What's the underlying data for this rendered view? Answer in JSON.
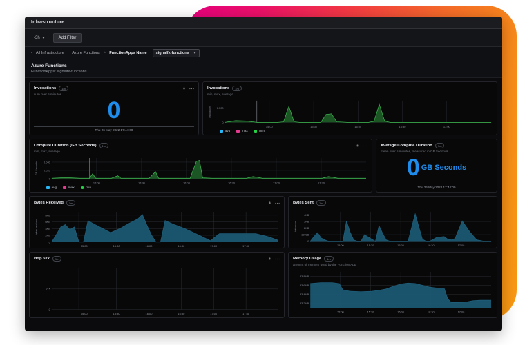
{
  "window": {
    "title": "Infrastructure"
  },
  "toolbar": {
    "time_range": "-3h",
    "add_filter_label": "Add Filter"
  },
  "breadcrumb": {
    "back_icon": "chevron-left-icon",
    "root": "All Infrastructure",
    "separator_1": "|",
    "section": "Azure Functions",
    "separator_2": ">",
    "label": "FunctionApps Name",
    "selected_value": "signalfx-functions",
    "caret_icon": "chevron-down-icon"
  },
  "page": {
    "title": "Azure Functions",
    "subtitle": "FunctionApps: signalfx-functions"
  },
  "icons": {
    "bell": "bell-icon",
    "dots": "more-options-icon"
  },
  "panels": {
    "invocations_single": {
      "title": "Invocations",
      "badge": "1m",
      "subtitle": "sum over 5 minutes",
      "value": "0",
      "footer": "Thu 26 May 2022 17:44:00"
    },
    "invocations_chart": {
      "title": "Invocations",
      "badge": "1m",
      "subtitle": "min, max, average"
    },
    "compute_duration": {
      "title": "Compute Duration (GB Seconds)",
      "badge": "1m",
      "subtitle": "min, max, average"
    },
    "avg_compute_duration": {
      "title": "Average Compute Duration",
      "badge": "1m",
      "subtitle": "mean over 5 minutes, measured in GB Seconds",
      "value": "0",
      "unit": "GB Seconds",
      "footer": "Thu 26 May 2022 17:44:00"
    },
    "bytes_received": {
      "title": "Bytes Received",
      "badge": "1m"
    },
    "bytes_sent": {
      "title": "Bytes Sent",
      "badge": "1m"
    },
    "http_5xx": {
      "title": "Http 5xx",
      "badge": "1m"
    },
    "memory_usage": {
      "title": "Memory Usage",
      "badge": "1m",
      "subtitle": "amount of memory used by the Function App"
    }
  },
  "legend": {
    "avg": {
      "label": "avg",
      "color": "#29b6f6"
    },
    "max": {
      "label": "max",
      "color": "#e3398f"
    },
    "min": {
      "label": "min",
      "color": "#27d145"
    }
  },
  "colors": {
    "accent_blue": "#1f8ceb",
    "area_teal": "#1f607d",
    "line_green": "#3fbf53",
    "gradient_start": "#e5007d",
    "gradient_end": "#f99a12"
  },
  "chart_data": [
    {
      "id": "invocations_chart",
      "type": "area",
      "title": "Invocations",
      "ylabel": "invocations",
      "xlabel": "",
      "ylim": [
        0,
        0.75
      ],
      "yticks": [
        "0",
        "0.500"
      ],
      "ytick_values": [
        0,
        0.5
      ],
      "xticks": [
        "15:00",
        "15:30",
        "16:00",
        "16:30",
        "17:00"
      ],
      "grid": true,
      "legend_position": "bottom-left",
      "series": [
        {
          "name": "min",
          "color": "#3fbf53",
          "x": [
            0,
            4,
            8,
            12,
            16,
            20,
            22,
            24,
            26,
            28,
            32,
            36,
            38,
            40,
            42,
            46,
            50,
            54,
            56,
            58,
            60,
            62,
            66,
            70,
            74,
            78,
            82,
            86,
            90,
            94,
            100
          ],
          "values": [
            0,
            0.06,
            0.05,
            0,
            0,
            0,
            0.02,
            0.55,
            0.02,
            0,
            0,
            0,
            0.28,
            0.3,
            0.02,
            0,
            0,
            0,
            0.04,
            0.62,
            0.05,
            0,
            0,
            0,
            0,
            0,
            0,
            0,
            0,
            0,
            0
          ]
        },
        {
          "name": "max",
          "color": "#e3398f",
          "x": [],
          "values": []
        },
        {
          "name": "avg",
          "color": "#29b6f6",
          "x": [],
          "values": []
        }
      ]
    },
    {
      "id": "compute_duration",
      "type": "area",
      "title": "Compute Duration (GB Seconds)",
      "ylabel": "GB Seconds",
      "xlabel": "",
      "ylim": [
        0,
        0.05
      ],
      "yticks": [
        "0",
        "0.020",
        "0.040"
      ],
      "ytick_values": [
        0,
        0.02,
        0.04
      ],
      "xticks": [
        "15:00",
        "15:30",
        "16:00",
        "16:30",
        "17:00",
        "17:30"
      ],
      "grid": true,
      "legend_position": "bottom-left",
      "series": [
        {
          "name": "min",
          "color": "#3fbf53",
          "x": [
            0,
            3,
            6,
            9,
            12,
            13,
            14,
            16,
            19,
            21,
            22,
            24,
            27,
            31,
            33,
            34,
            36,
            40,
            44,
            46,
            47,
            48,
            51,
            56,
            62,
            64,
            65,
            67,
            72,
            78,
            86,
            88,
            89,
            91,
            96,
            100
          ],
          "values": [
            0.001,
            0.002,
            0.002,
            0.001,
            0.001,
            0.012,
            0.001,
            0.001,
            0.001,
            0.007,
            0.001,
            0.001,
            0.001,
            0.001,
            0.017,
            0.001,
            0.001,
            0.001,
            0.001,
            0.042,
            0.044,
            0.002,
            0.001,
            0.001,
            0.001,
            0.005,
            0.004,
            0.001,
            0.001,
            0.001,
            0.001,
            0.005,
            0.004,
            0.001,
            0.001,
            0.001
          ]
        },
        {
          "name": "max",
          "color": "#e3398f",
          "x": [],
          "values": []
        },
        {
          "name": "avg",
          "color": "#29b6f6",
          "x": [],
          "values": []
        }
      ]
    },
    {
      "id": "bytes_received",
      "type": "area",
      "title": "Bytes Received",
      "ylabel": "bytes received",
      "xlabel": "",
      "ylim": [
        0,
        9000
      ],
      "yticks": [
        "0",
        "2KB",
        "4KB",
        "6KB",
        "8KB"
      ],
      "ytick_values": [
        0,
        2000,
        4000,
        6000,
        8000
      ],
      "xticks": [
        "15:00",
        "15:30",
        "16:00",
        "16:30",
        "17:00",
        "17:30"
      ],
      "grid": true,
      "series": [
        {
          "name": "bytes received",
          "color": "#1f607d",
          "x": [
            0,
            2,
            4,
            6,
            8,
            10,
            12,
            14,
            16,
            18,
            22,
            26,
            30,
            34,
            38,
            40,
            42,
            44,
            46,
            48,
            50,
            54,
            58,
            62,
            66,
            70,
            74,
            78,
            82,
            90,
            96,
            100
          ],
          "values": [
            0,
            2200,
            4500,
            5200,
            3700,
            4500,
            0,
            0,
            6400,
            5600,
            4200,
            2800,
            4000,
            5500,
            6900,
            8200,
            5000,
            2100,
            0,
            0,
            6400,
            5200,
            4200,
            3000,
            1700,
            400,
            2500,
            2500,
            2500,
            2500,
            1500,
            500
          ]
        }
      ]
    },
    {
      "id": "bytes_sent",
      "type": "area",
      "title": "Bytes Sent",
      "ylabel": "bytes sent",
      "xlabel": "",
      "ylim": [
        0,
        4500
      ],
      "yticks": [
        "0",
        "1000B",
        "2KB",
        "3KB",
        "4KB"
      ],
      "ytick_values": [
        0,
        1000,
        2000,
        3000,
        4000
      ],
      "xticks": [
        "15:00",
        "15:30",
        "16:00",
        "16:30",
        "17:00"
      ],
      "grid": true,
      "series": [
        {
          "name": "bytes sent",
          "color": "#1f607d",
          "x": [
            0,
            2,
            4,
            6,
            8,
            10,
            14,
            18,
            20,
            22,
            24,
            26,
            28,
            30,
            34,
            36,
            38,
            40,
            42,
            44,
            46,
            50,
            54,
            58,
            60,
            62,
            64,
            66,
            70,
            74,
            76,
            78,
            80,
            84,
            88,
            92,
            96,
            100
          ],
          "values": [
            0,
            700,
            1300,
            500,
            200,
            0,
            0,
            0,
            3100,
            1400,
            200,
            0,
            0,
            1000,
            300,
            0,
            2400,
            1200,
            200,
            0,
            0,
            0,
            0,
            4200,
            2200,
            300,
            0,
            0,
            600,
            700,
            300,
            200,
            400,
            3100,
            1500,
            200,
            0,
            0
          ]
        }
      ]
    },
    {
      "id": "http_5xx",
      "type": "line",
      "title": "Http 5xx",
      "ylabel": "",
      "xlabel": "",
      "ylim": [
        0,
        1
      ],
      "yticks": [
        "0",
        "0.5"
      ],
      "ytick_values": [
        0,
        0.5
      ],
      "xticks": [
        "15:00",
        "15:30",
        "16:00",
        "16:30",
        "17:00",
        "17:30"
      ],
      "grid": true,
      "series": [
        {
          "name": "http 5xx",
          "color": "#3fbf53",
          "x": [],
          "values": []
        }
      ]
    },
    {
      "id": "memory_usage",
      "type": "area",
      "title": "Memory Usage",
      "ylabel": "",
      "xlabel": "",
      "ylim": [
        33.1,
        33.9
      ],
      "yticks": [
        "33.2MB",
        "33.4MB",
        "33.6MB",
        "33.8MB"
      ],
      "ytick_values": [
        33.2,
        33.4,
        33.6,
        33.8
      ],
      "xticks": [
        "15:00",
        "15:30",
        "16:00",
        "16:30",
        "17:00"
      ],
      "grid": true,
      "series": [
        {
          "name": "memory",
          "color": "#1f607d",
          "x": [
            0,
            6,
            12,
            16,
            18,
            22,
            28,
            34,
            38,
            42,
            46,
            50,
            54,
            58,
            62,
            66,
            70,
            74,
            76,
            78,
            82,
            86,
            90,
            94,
            100
          ],
          "values": [
            33.64,
            33.66,
            33.66,
            33.64,
            33.5,
            33.47,
            33.46,
            33.47,
            33.49,
            33.52,
            33.58,
            33.63,
            33.65,
            33.64,
            33.6,
            33.56,
            33.54,
            33.54,
            33.3,
            33.22,
            33.22,
            33.23,
            33.26,
            33.27,
            33.27
          ]
        }
      ]
    }
  ]
}
